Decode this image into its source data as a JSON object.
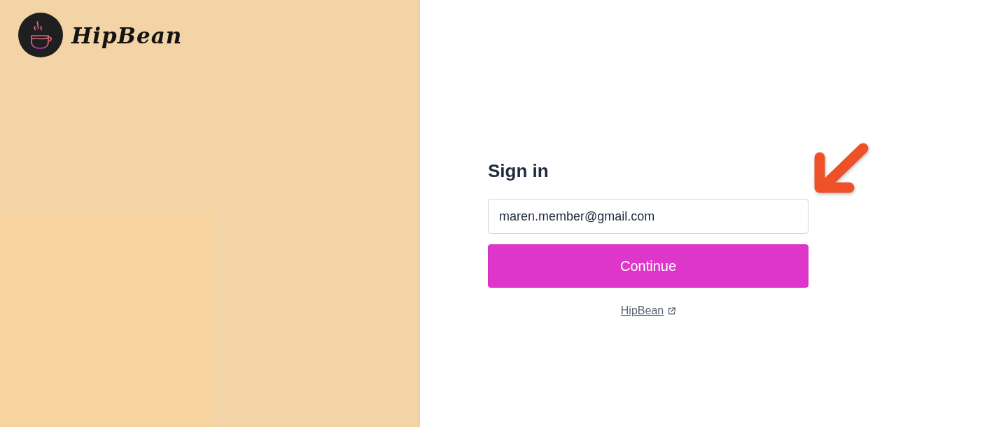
{
  "brand": {
    "name": "HipBean"
  },
  "sign_in": {
    "title": "Sign in",
    "email_field": {
      "value": "maren.member@gmail.com"
    },
    "continue_button": "Continue",
    "link": "HipBean"
  }
}
